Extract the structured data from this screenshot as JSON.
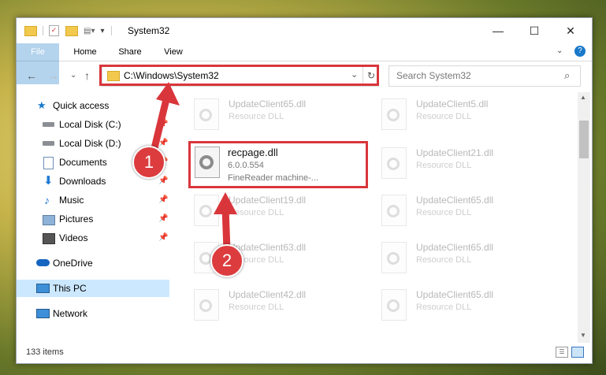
{
  "window": {
    "title": "System32",
    "controls": {
      "minimize": "—",
      "maximize": "☐",
      "close": "✕"
    }
  },
  "ribbon": {
    "tabs": [
      "File",
      "Home",
      "Share",
      "View"
    ]
  },
  "address": {
    "path": "C:\\Windows\\System32",
    "search_placeholder": "Search System32"
  },
  "sidebar": {
    "items": [
      {
        "label": "Quick access",
        "icon": "star-icon",
        "pinned": false
      },
      {
        "label": "Local Disk (C:)",
        "icon": "drive-icon",
        "pinned": true
      },
      {
        "label": "Local Disk (D:)",
        "icon": "drive-icon",
        "pinned": true
      },
      {
        "label": "Documents",
        "icon": "documents-icon",
        "pinned": true
      },
      {
        "label": "Downloads",
        "icon": "download-icon",
        "pinned": true
      },
      {
        "label": "Music",
        "icon": "music-icon",
        "pinned": true
      },
      {
        "label": "Pictures",
        "icon": "pictures-icon",
        "pinned": true
      },
      {
        "label": "Videos",
        "icon": "videos-icon",
        "pinned": true
      },
      {
        "label": "OneDrive",
        "icon": "cloud-icon",
        "pinned": false
      },
      {
        "label": "This PC",
        "icon": "computer-icon",
        "pinned": false,
        "selected": true
      },
      {
        "label": "Network",
        "icon": "network-icon",
        "pinned": false
      }
    ]
  },
  "files": {
    "left_column": [
      {
        "name": "UpdateClient65.dll",
        "type": "Resource DLL"
      },
      {
        "name": "UpdateClient19.dll",
        "type": "Resource DLL"
      },
      {
        "name": "UpdateClient63.dll",
        "type": "Resource DLL"
      },
      {
        "name": "UpdateClient42.dll",
        "type": "Resource DLL"
      }
    ],
    "right_column": [
      {
        "name": "UpdateClient5.dll",
        "type": "Resource DLL"
      },
      {
        "name": "UpdateClient21.dll",
        "type": "Resource DLL"
      },
      {
        "name": "UpdateClient65.dll",
        "type": "Resource DLL"
      },
      {
        "name": "UpdateClient65.dll",
        "type": "Resource DLL"
      },
      {
        "name": "UpdateClient65.dll",
        "type": "Resource DLL"
      }
    ],
    "focused": {
      "name": "recpage.dll",
      "version": "6.0.0.554",
      "description": "FineReader machine-..."
    }
  },
  "status": {
    "item_count": "133 items"
  },
  "callouts": {
    "one": "1",
    "two": "2"
  },
  "colors": {
    "accent": "#1979ca",
    "callout_red": "#dc3c3e",
    "highlight_border": "#d9363c"
  }
}
